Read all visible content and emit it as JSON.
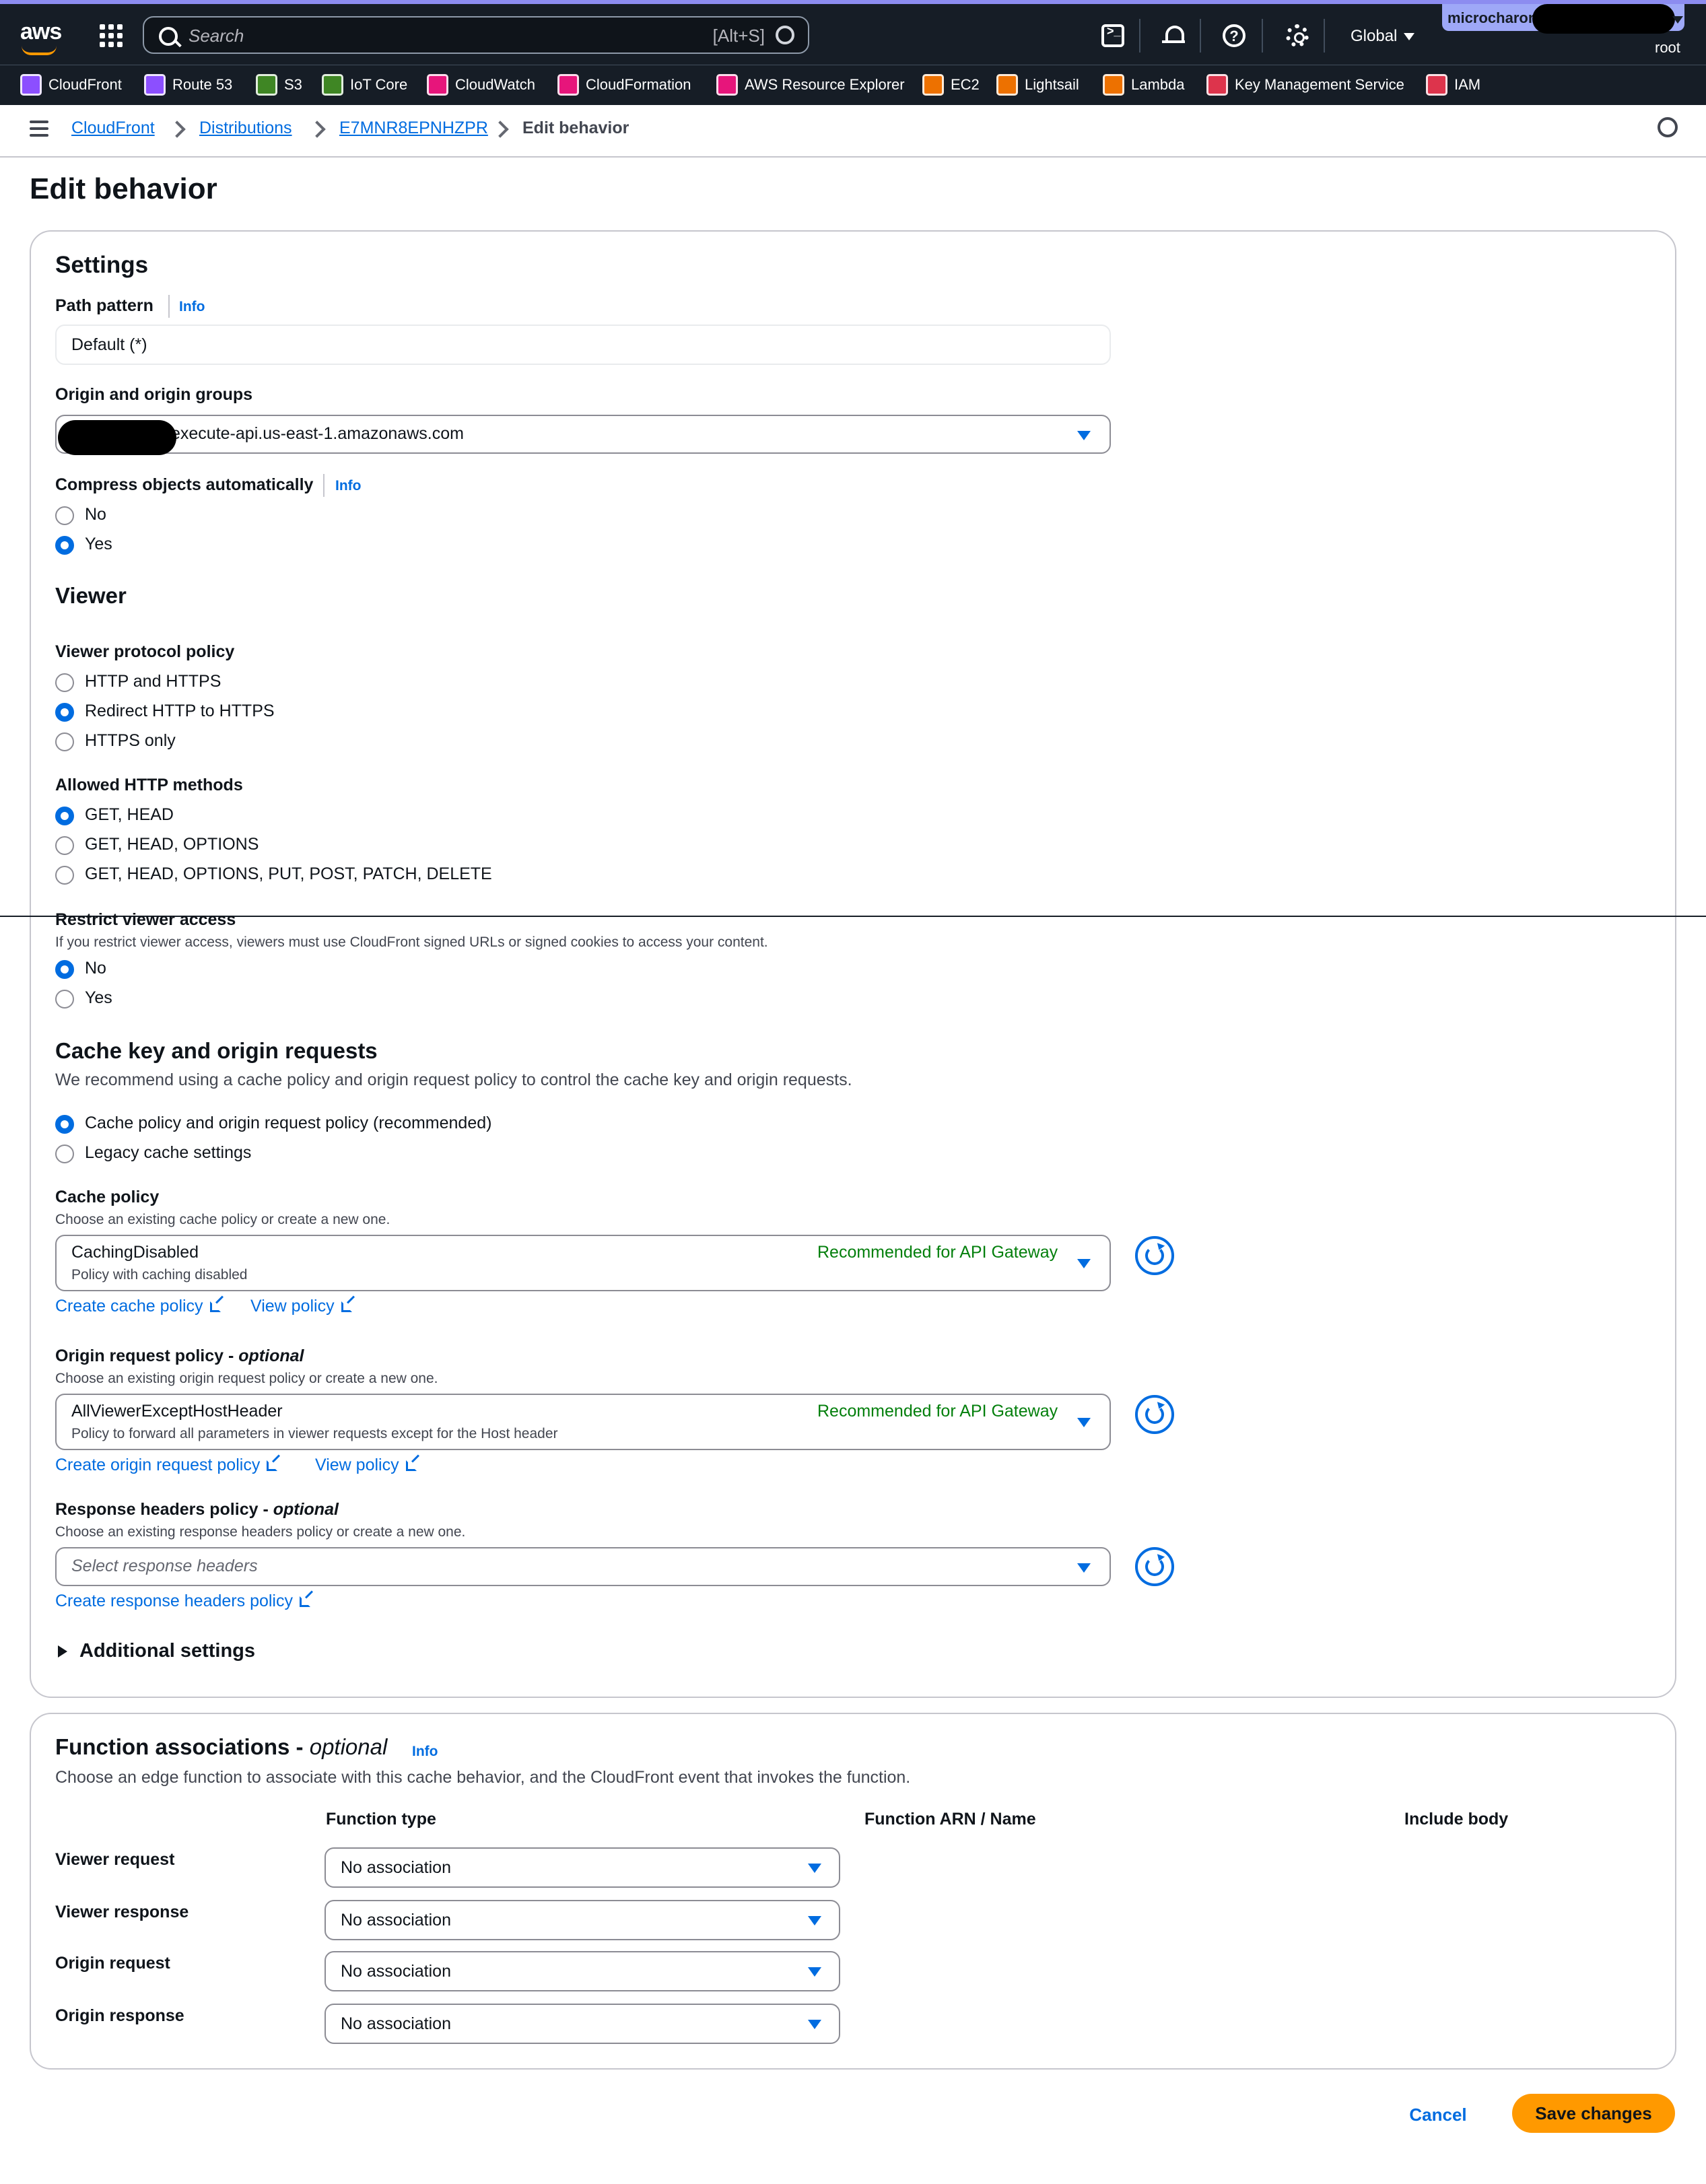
{
  "nav": {
    "search_placeholder": "Search",
    "search_shortcut": "[Alt+S]",
    "region": "Global",
    "account_name": "microcharon",
    "account_role": "root"
  },
  "favorites": [
    "CloudFront",
    "Route 53",
    "S3",
    "IoT Core",
    "CloudWatch",
    "CloudFormation",
    "AWS Resource Explorer",
    "EC2",
    "Lightsail",
    "Lambda",
    "Key Management Service",
    "IAM"
  ],
  "favorite_colors": [
    "#8c4fff",
    "#8c4fff",
    "#3f8624",
    "#3f8624",
    "#e7157b",
    "#e7157b",
    "#e7157b",
    "#ed7100",
    "#ed7100",
    "#ed7100",
    "#dd344c",
    "#dd344c"
  ],
  "breadcrumb": [
    "CloudFront",
    "Distributions",
    "E7MNR8EPNHZPR",
    "Edit behavior"
  ],
  "page": {
    "title": "Edit behavior"
  },
  "settings": {
    "heading": "Settings",
    "path_pattern_label": "Path pattern",
    "info": "Info",
    "path_pattern_value": "Default (*)",
    "origin_label": "Origin and origin groups",
    "origin_value": "execute-api.us-east-1.amazonaws.com",
    "compress_label": "Compress objects automatically",
    "compress_options": [
      "No",
      "Yes"
    ],
    "compress_selected": "Yes"
  },
  "viewer": {
    "heading": "Viewer",
    "protocol_label": "Viewer protocol policy",
    "protocol_options": [
      "HTTP and HTTPS",
      "Redirect HTTP to HTTPS",
      "HTTPS only"
    ],
    "protocol_selected": "Redirect HTTP to HTTPS",
    "methods_label": "Allowed HTTP methods",
    "methods_options": [
      "GET, HEAD",
      "GET, HEAD, OPTIONS",
      "GET, HEAD, OPTIONS, PUT, POST, PATCH, DELETE"
    ],
    "methods_selected": "GET, HEAD",
    "restrict_label": "Restrict viewer access",
    "restrict_desc": "If you restrict viewer access, viewers must use CloudFront signed URLs or signed cookies to access your content.",
    "restrict_options": [
      "No",
      "Yes"
    ],
    "restrict_selected": "No"
  },
  "cache": {
    "heading": "Cache key and origin requests",
    "desc": "We recommend using a cache policy and origin request policy to control the cache key and origin requests.",
    "mode_options": [
      "Cache policy and origin request policy (recommended)",
      "Legacy cache settings"
    ],
    "mode_selected": "Cache policy and origin request policy (recommended)",
    "cache_policy_label": "Cache policy",
    "cache_policy_desc": "Choose an existing cache policy or create a new one.",
    "cache_policy_value": "CachingDisabled",
    "cache_policy_sub": "Policy with caching disabled",
    "recommended": "Recommended for API Gateway",
    "create_cache_policy": "Create cache policy",
    "view_policy": "View policy",
    "orp_label": "Origin request policy - ",
    "optional": "optional",
    "orp_desc": "Choose an existing origin request policy or create a new one.",
    "orp_value": "AllViewerExceptHostHeader",
    "orp_sub": "Policy to forward all parameters in viewer requests except for the Host header",
    "create_orp": "Create origin request policy",
    "rhp_label": "Response headers policy - ",
    "rhp_desc": "Choose an existing response headers policy or create a new one.",
    "rhp_placeholder": "Select response headers",
    "create_rhp": "Create response headers policy",
    "additional": "Additional settings"
  },
  "functions": {
    "heading": "Function associations - ",
    "optional": "optional",
    "info": "Info",
    "desc": "Choose an edge function to associate with this cache behavior, and the CloudFront event that invokes the function.",
    "col_type": "Function type",
    "col_arn": "Function ARN / Name",
    "col_body": "Include body",
    "rows": [
      {
        "event": "Viewer request",
        "value": "No association"
      },
      {
        "event": "Viewer response",
        "value": "No association"
      },
      {
        "event": "Origin request",
        "value": "No association"
      },
      {
        "event": "Origin response",
        "value": "No association"
      }
    ]
  },
  "footer": {
    "cancel": "Cancel",
    "save": "Save changes"
  }
}
